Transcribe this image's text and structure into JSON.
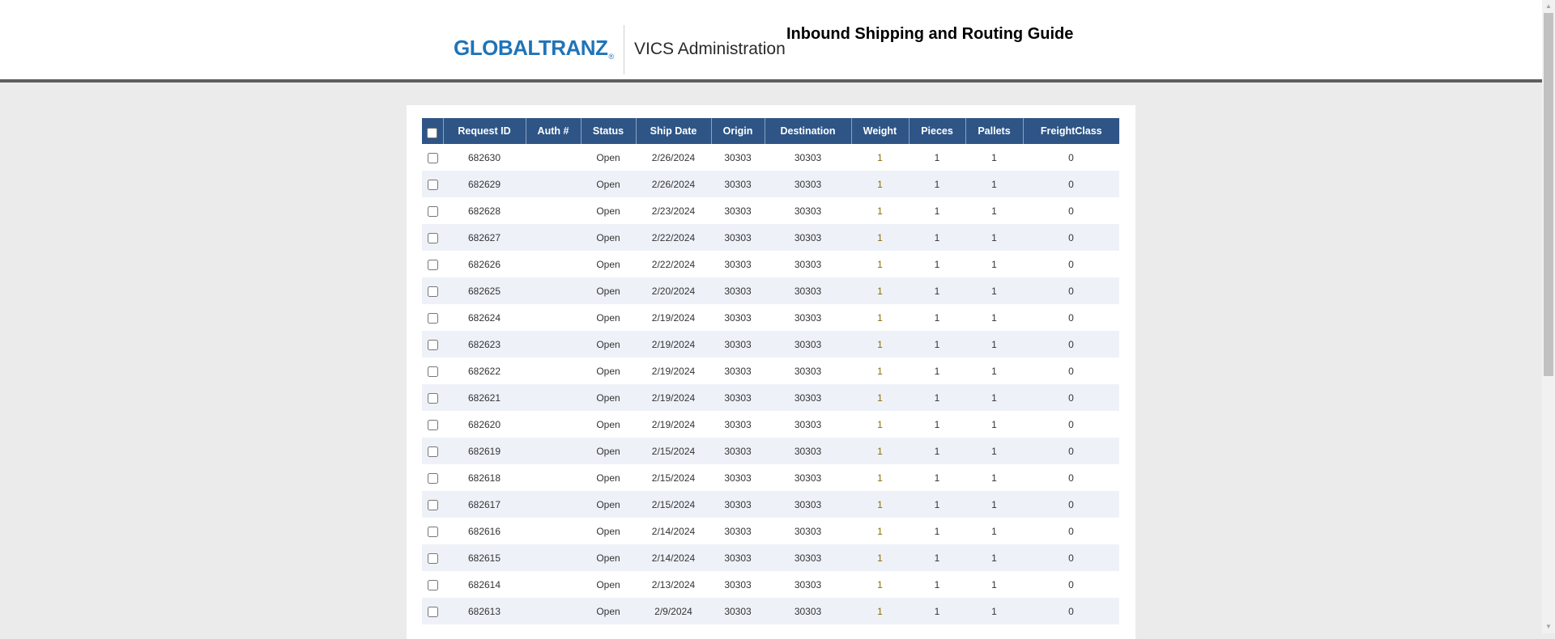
{
  "header": {
    "logo": "GLOBALTRANZ",
    "logo_mark": "®",
    "app_name": "VICS Administration",
    "page_title": "Inbound Shipping and Routing Guide"
  },
  "table": {
    "columns": [
      "Request ID",
      "Auth #",
      "Status",
      "Ship Date",
      "Origin",
      "Destination",
      "Weight",
      "Pieces",
      "Pallets",
      "FreightClass"
    ],
    "rows": [
      [
        "682630",
        "",
        "Open",
        "2/26/2024",
        "30303",
        "30303",
        "1",
        "1",
        "1",
        "0"
      ],
      [
        "682629",
        "",
        "Open",
        "2/26/2024",
        "30303",
        "30303",
        "1",
        "1",
        "1",
        "0"
      ],
      [
        "682628",
        "",
        "Open",
        "2/23/2024",
        "30303",
        "30303",
        "1",
        "1",
        "1",
        "0"
      ],
      [
        "682627",
        "",
        "Open",
        "2/22/2024",
        "30303",
        "30303",
        "1",
        "1",
        "1",
        "0"
      ],
      [
        "682626",
        "",
        "Open",
        "2/22/2024",
        "30303",
        "30303",
        "1",
        "1",
        "1",
        "0"
      ],
      [
        "682625",
        "",
        "Open",
        "2/20/2024",
        "30303",
        "30303",
        "1",
        "1",
        "1",
        "0"
      ],
      [
        "682624",
        "",
        "Open",
        "2/19/2024",
        "30303",
        "30303",
        "1",
        "1",
        "1",
        "0"
      ],
      [
        "682623",
        "",
        "Open",
        "2/19/2024",
        "30303",
        "30303",
        "1",
        "1",
        "1",
        "0"
      ],
      [
        "682622",
        "",
        "Open",
        "2/19/2024",
        "30303",
        "30303",
        "1",
        "1",
        "1",
        "0"
      ],
      [
        "682621",
        "",
        "Open",
        "2/19/2024",
        "30303",
        "30303",
        "1",
        "1",
        "1",
        "0"
      ],
      [
        "682620",
        "",
        "Open",
        "2/19/2024",
        "30303",
        "30303",
        "1",
        "1",
        "1",
        "0"
      ],
      [
        "682619",
        "",
        "Open",
        "2/15/2024",
        "30303",
        "30303",
        "1",
        "1",
        "1",
        "0"
      ],
      [
        "682618",
        "",
        "Open",
        "2/15/2024",
        "30303",
        "30303",
        "1",
        "1",
        "1",
        "0"
      ],
      [
        "682617",
        "",
        "Open",
        "2/15/2024",
        "30303",
        "30303",
        "1",
        "1",
        "1",
        "0"
      ],
      [
        "682616",
        "",
        "Open",
        "2/14/2024",
        "30303",
        "30303",
        "1",
        "1",
        "1",
        "0"
      ],
      [
        "682615",
        "",
        "Open",
        "2/14/2024",
        "30303",
        "30303",
        "1",
        "1",
        "1",
        "0"
      ],
      [
        "682614",
        "",
        "Open",
        "2/13/2024",
        "30303",
        "30303",
        "1",
        "1",
        "1",
        "0"
      ],
      [
        "682613",
        "",
        "Open",
        "2/9/2024",
        "30303",
        "30303",
        "1",
        "1",
        "1",
        "0"
      ]
    ]
  },
  "colors": {
    "header_bg": "#2e5586",
    "brand": "#1f74b8",
    "row_alt": "#eef2f8"
  }
}
